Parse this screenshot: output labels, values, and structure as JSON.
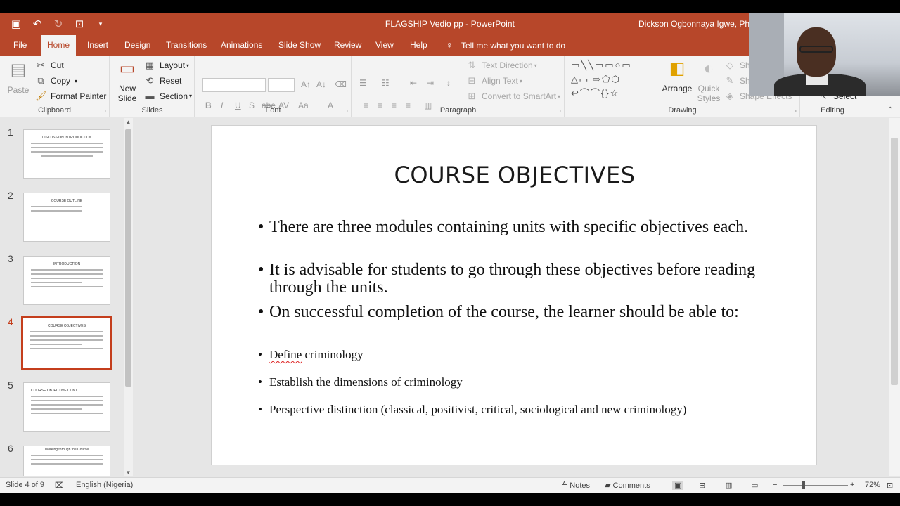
{
  "window": {
    "title": "FLAGSHIP Vedio pp  -  PowerPoint",
    "user": "Dickson Ogbonnaya Igwe, Ph.D"
  },
  "tabs": [
    "File",
    "Home",
    "Insert",
    "Design",
    "Transitions",
    "Animations",
    "Slide Show",
    "Review",
    "View",
    "Help"
  ],
  "tell_me": "Tell me what you want to do",
  "ribbon": {
    "clipboard": {
      "label": "Clipboard",
      "paste": "Paste",
      "cut": "Cut",
      "copy": "Copy",
      "format_painter": "Format Painter"
    },
    "slides": {
      "label": "Slides",
      "new_slide_1": "New",
      "new_slide_2": "Slide",
      "layout": "Layout",
      "reset": "Reset",
      "section": "Section"
    },
    "font": {
      "label": "Font"
    },
    "paragraph": {
      "label": "Paragraph",
      "text_direction": "Text Direction",
      "align_text": "Align Text",
      "convert_smartart": "Convert to SmartArt"
    },
    "drawing": {
      "label": "Drawing",
      "arrange": "Arrange",
      "quick_styles_1": "Quick",
      "quick_styles_2": "Styles",
      "shape_fill": "Sha",
      "shape_outline": "Sha",
      "shape_effects": "Shape Effects"
    },
    "editing": {
      "label": "Editing",
      "select": "Select"
    }
  },
  "thumbnails": [
    {
      "num": "1",
      "title": "DISCUSSION INTRODUCTION"
    },
    {
      "num": "2",
      "title": "COURSE OUTLINE"
    },
    {
      "num": "3",
      "title": "INTRODUCTION"
    },
    {
      "num": "4",
      "title": "COURSE OBJECTIVES"
    },
    {
      "num": "5",
      "title": "COURSE OBJECTIVE CONT."
    },
    {
      "num": "6",
      "title": "Working through the Course"
    }
  ],
  "slide": {
    "title": "COURSE OBJECTIVES",
    "bullets": [
      "There are three modules containing units with specific objectives each.",
      "It is advisable for students to go through these objectives before reading through the units.",
      "On successful completion of the course, the learner should be able to:"
    ],
    "sub_bullets": [
      "Define criminology",
      "Establish the dimensions of criminology",
      "Perspective distinction (classical, positivist, critical, sociological and new criminology)"
    ],
    "squiggle_word": "Define",
    "squiggle_rest": " criminology"
  },
  "status": {
    "slide_of": "Slide 4 of 9",
    "language": "English (Nigeria)",
    "notes": "Notes",
    "comments": "Comments",
    "zoom": "72%"
  }
}
